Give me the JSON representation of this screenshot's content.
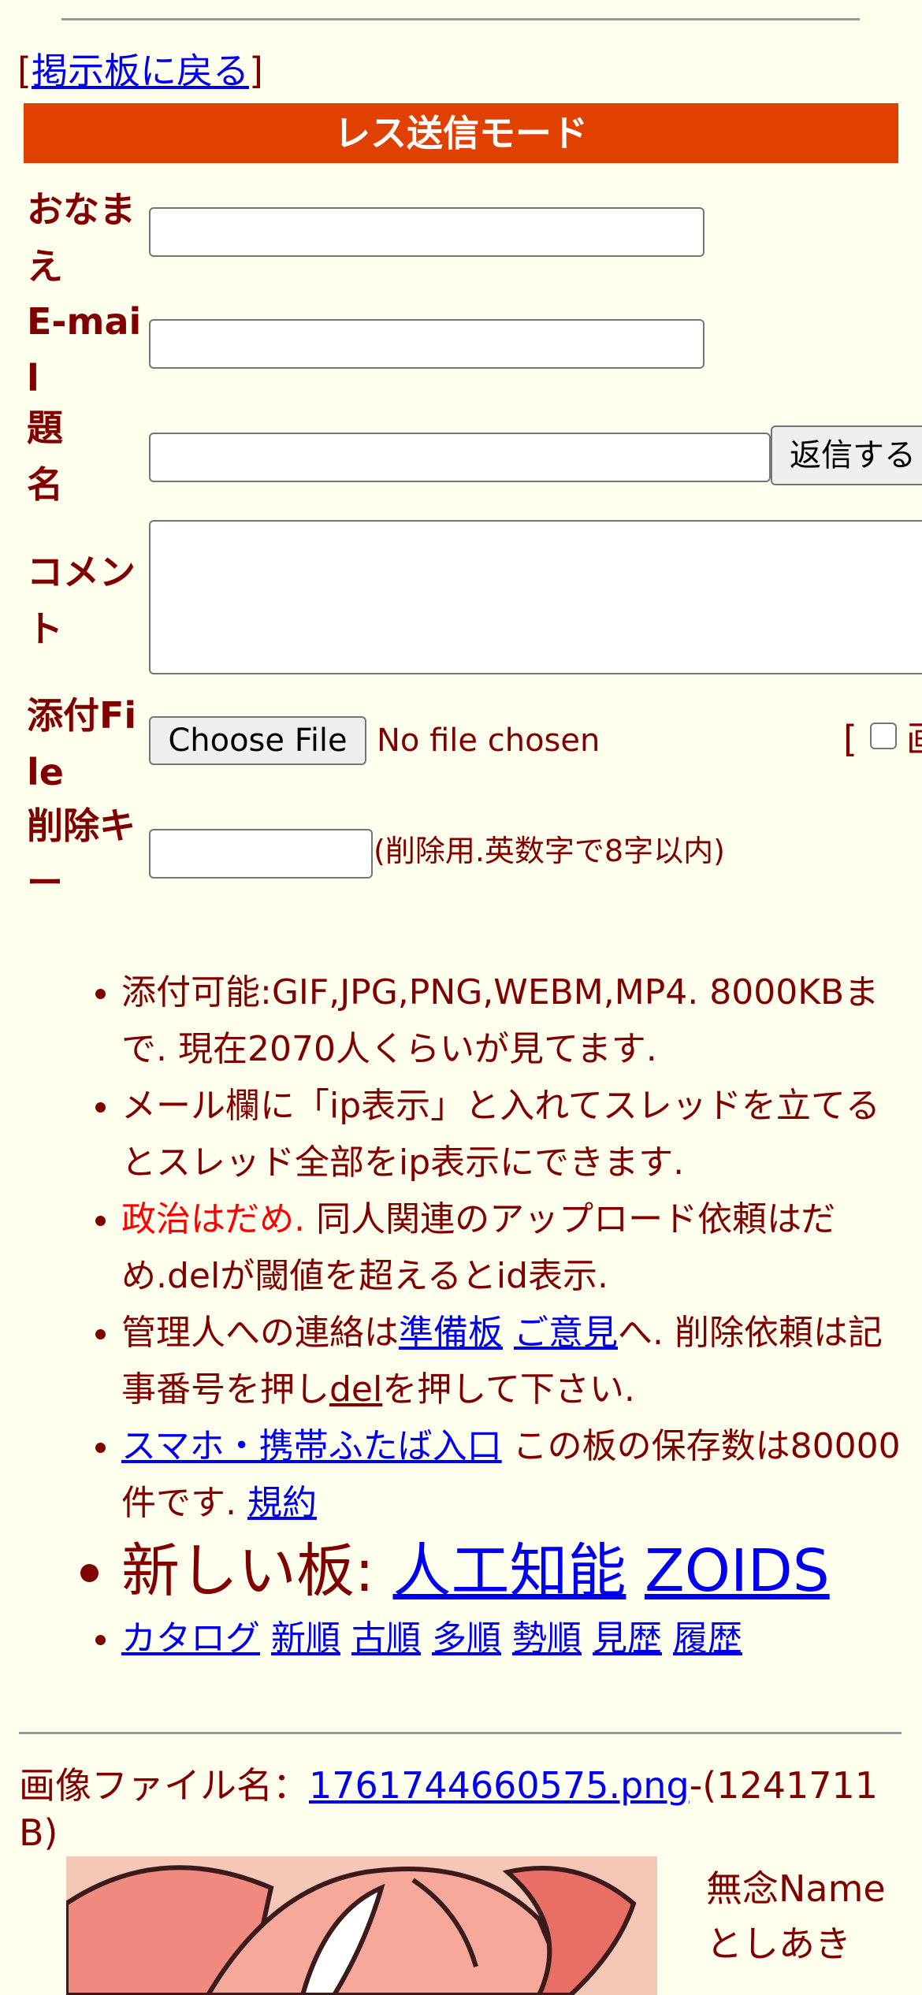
{
  "nav": {
    "back_label": "掲示板に戻る"
  },
  "banner": {
    "title": "レス送信モード"
  },
  "form": {
    "name_label": "おなまえ",
    "email_label": "E-mail",
    "subject_label": "題名",
    "submit_label": "返信する",
    "comment_label": "コメント",
    "attach_label": "添付File",
    "choose_file_label": "Choose File",
    "no_file_text": "No file chosen",
    "image_option_partial": "画",
    "delkey_label": "削除キー",
    "delkey_hint": "(削除用.英数字で8字以内)"
  },
  "info": {
    "line1": "添付可能:GIF,JPG,PNG,WEBM,MP4. 8000KBまで. 現在2070人くらいが見てます.",
    "line2": "メール欄に「ip表示」と入れてスレッドを立てるとスレッド全部をip表示にできます.",
    "line3_red": "政治はだめ.",
    "line3_rest": " 同人関連のアップロード依頼はだめ.delが閾値を超えるとid表示.",
    "line4_pre": "管理人への連絡は",
    "line4_link1": "準備板",
    "line4_link2": "ご意見",
    "line4_mid": "へ. 削除依頼は記事番号を押し",
    "line4_link3": "del",
    "line4_post": "を押して下さい.",
    "line5_link": "スマホ・携帯ふたば入口",
    "line5_mid": " この板の保存数は80000件です. ",
    "line5_link2": "規約",
    "line6_label": "新しい板: ",
    "line6_link1": "人工知能",
    "line6_link2": "ZOIDS",
    "links": [
      "カタログ",
      "新順",
      "古順",
      "多順",
      "勢順",
      "見歴",
      "履歴"
    ]
  },
  "post": {
    "file_label": "画像ファイル名：",
    "file_link": "1761744660575.png",
    "file_size": "-(1241711 B)",
    "poster_name": "無念Name",
    "poster_name2": "としあき"
  },
  "colors": {
    "banner": "#e04000",
    "text": "#800000",
    "bg": "#ffffee",
    "link": "#0000ee"
  }
}
